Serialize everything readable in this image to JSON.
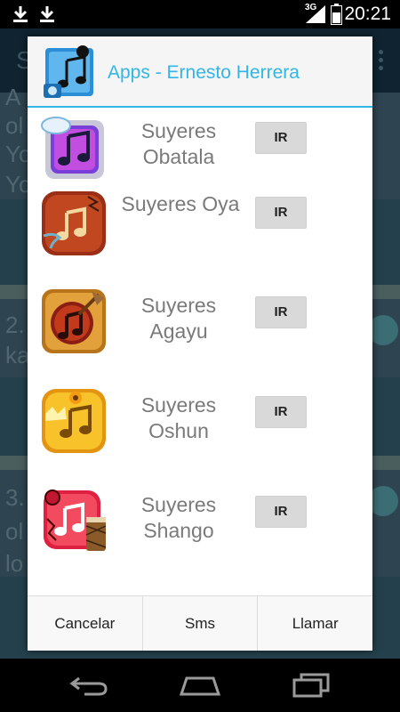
{
  "status_bar": {
    "time": "20:21",
    "network": "3G",
    "icons": [
      "download-icon",
      "download-icon",
      "signal-icon",
      "battery-icon"
    ]
  },
  "background": {
    "title_letter": "S",
    "lines": [
      "A",
      "ol",
      "Yo",
      "Yo",
      "2.",
      "ka",
      "3.",
      "ol",
      "lo"
    ]
  },
  "dialog": {
    "title": "Apps - Ernesto Herrera",
    "items": [
      {
        "name_line1": "Suyeres",
        "name_line2": "Obatala",
        "button": "IR",
        "icon": "music-note-cloud-icon"
      },
      {
        "name_line1": "Suyeres Oya",
        "name_line2": "",
        "button": "IR",
        "icon": "music-note-tornado-icon"
      },
      {
        "name_line1": "Suyeres",
        "name_line2": "Agayu",
        "button": "IR",
        "icon": "music-note-axe-icon"
      },
      {
        "name_line1": "Suyeres",
        "name_line2": "Oshun",
        "button": "IR",
        "icon": "music-note-sunflower-icon"
      },
      {
        "name_line1": "Suyeres",
        "name_line2": "Shango",
        "button": "IR",
        "icon": "music-note-drum-icon"
      }
    ],
    "footer": {
      "cancel_label": "Cancelar",
      "sms_label": "Sms",
      "call_label": "Llamar"
    }
  },
  "colors": {
    "accent": "#33b5e5",
    "button_bg": "#d9d9d9"
  }
}
